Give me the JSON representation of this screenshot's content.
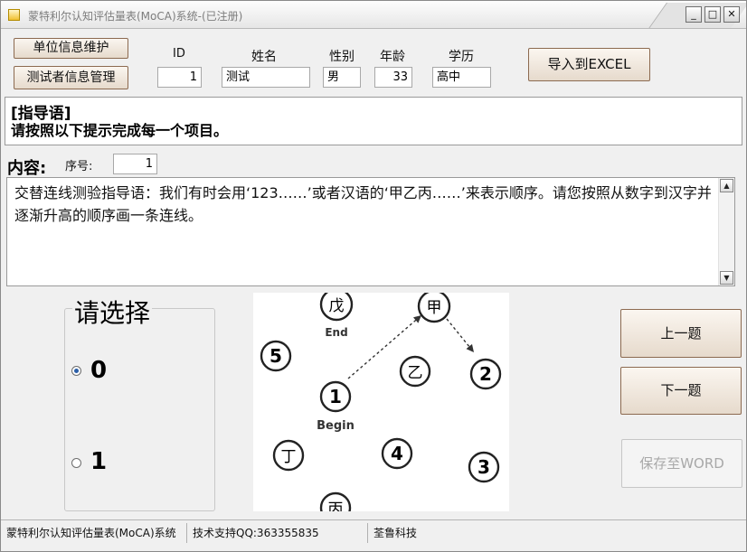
{
  "window": {
    "title": "蒙特利尔认知评估量表(MoCA)系统-(已注册)",
    "controls": {
      "minimize": "_",
      "maximize": "□",
      "close": "✕"
    }
  },
  "toolbar": {
    "unit_info_button": "单位信息维护",
    "tester_info_button": "测试者信息管理",
    "export_excel_button": "导入到EXCEL"
  },
  "subject": {
    "id_label": "ID",
    "id_value": "1",
    "name_label": "姓名",
    "name_value": "测试",
    "gender_label": "性别",
    "gender_value": "男",
    "age_label": "年龄",
    "age_value": "33",
    "education_label": "学历",
    "education_value": "高中"
  },
  "instructions": {
    "heading": "[指导语]",
    "text": "请按照以下提示完成每一个项目。"
  },
  "content": {
    "label": "内容:",
    "seq_label": "序号:",
    "seq_value": "1",
    "text": "交替连线测验指导语：我们有时会用‘123……’或者汉语的‘甲乙丙……’来表示顺序。请您按照从数字到汉字并逐渐升高的顺序画一条连线。"
  },
  "selection": {
    "title": "请选择",
    "options": [
      {
        "label": "0",
        "selected": true
      },
      {
        "label": "1",
        "selected": false
      }
    ]
  },
  "figure": {
    "nodes": [
      "戊",
      "甲",
      "5",
      "乙",
      "2",
      "1",
      "丁",
      "4",
      "3",
      "丙"
    ],
    "end_label": "End",
    "begin_label": "Begin"
  },
  "navigation": {
    "prev_button": "上一题",
    "next_button": "下一题",
    "save_word_button": "保存至WORD"
  },
  "statusbar": {
    "app_name": "蒙特利尔认知评估量表(MoCA)系统",
    "support": "技术支持QQ:363355835",
    "company": "荃鲁科技"
  },
  "colors": {
    "accent": "#2b5fa8",
    "warm_button": "#e6dacc",
    "disabled_text": "#a8a8a8"
  }
}
